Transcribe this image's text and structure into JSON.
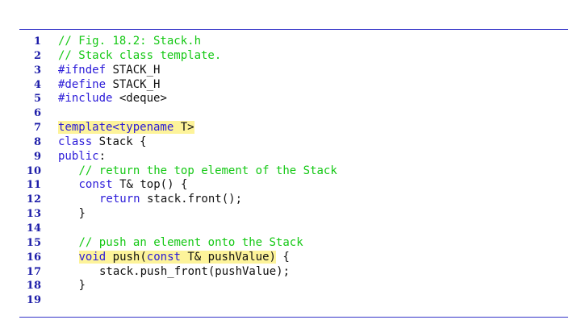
{
  "colors": {
    "comment": "#14c814",
    "keyword": "#2a1ad8",
    "line_number": "#1c1ca8",
    "highlight": "#fdf39a",
    "rule": "#3434c8"
  },
  "lines": [
    {
      "n": "1",
      "indent": 0,
      "tokens": [
        {
          "t": "// Fig. 18.2: Stack.h",
          "c": "comment"
        }
      ]
    },
    {
      "n": "2",
      "indent": 0,
      "tokens": [
        {
          "t": "// Stack class template.",
          "c": "comment"
        }
      ]
    },
    {
      "n": "3",
      "indent": 0,
      "tokens": [
        {
          "t": "#ifndef",
          "c": "keyword"
        },
        {
          "t": " STACK_H",
          "c": "plain"
        }
      ]
    },
    {
      "n": "4",
      "indent": 0,
      "tokens": [
        {
          "t": "#define",
          "c": "keyword"
        },
        {
          "t": " STACK_H",
          "c": "plain"
        }
      ]
    },
    {
      "n": "5",
      "indent": 0,
      "tokens": [
        {
          "t": "#include",
          "c": "keyword"
        },
        {
          "t": " <deque>",
          "c": "plain"
        }
      ]
    },
    {
      "n": "6",
      "indent": 0,
      "tokens": []
    },
    {
      "n": "7",
      "indent": 0,
      "tokens": [
        {
          "t": "template<typename",
          "c": "keyword",
          "hl": true
        },
        {
          "t": " T>",
          "c": "plain",
          "hl": true
        }
      ]
    },
    {
      "n": "8",
      "indent": 0,
      "tokens": [
        {
          "t": "class",
          "c": "keyword"
        },
        {
          "t": " Stack {",
          "c": "plain"
        }
      ]
    },
    {
      "n": "9",
      "indent": 0,
      "tokens": [
        {
          "t": "public",
          "c": "keyword"
        },
        {
          "t": ":",
          "c": "plain"
        }
      ]
    },
    {
      "n": "10",
      "indent": 1,
      "tokens": [
        {
          "t": "// return the top element of the Stack",
          "c": "comment"
        }
      ]
    },
    {
      "n": "11",
      "indent": 1,
      "tokens": [
        {
          "t": "const",
          "c": "keyword"
        },
        {
          "t": " T& top() {",
          "c": "plain"
        }
      ]
    },
    {
      "n": "12",
      "indent": 2,
      "tokens": [
        {
          "t": "return",
          "c": "keyword"
        },
        {
          "t": " stack.front();",
          "c": "plain"
        }
      ]
    },
    {
      "n": "13",
      "indent": 1,
      "tokens": [
        {
          "t": "}",
          "c": "plain"
        }
      ]
    },
    {
      "n": "14",
      "indent": 0,
      "tokens": []
    },
    {
      "n": "15",
      "indent": 1,
      "tokens": [
        {
          "t": "// push an element onto the Stack",
          "c": "comment"
        }
      ]
    },
    {
      "n": "16",
      "indent": 1,
      "tokens": [
        {
          "t": "void",
          "c": "keyword",
          "hl": true
        },
        {
          "t": " push(",
          "c": "plain",
          "hl": true
        },
        {
          "t": "const",
          "c": "keyword",
          "hl": true
        },
        {
          "t": " T& pushValue)",
          "c": "plain",
          "hl": true
        },
        {
          "t": " {",
          "c": "plain"
        }
      ]
    },
    {
      "n": "17",
      "indent": 2,
      "tokens": [
        {
          "t": "stack.push_front(pushValue);",
          "c": "plain"
        }
      ]
    },
    {
      "n": "18",
      "indent": 1,
      "tokens": [
        {
          "t": "}",
          "c": "plain"
        }
      ]
    },
    {
      "n": "19",
      "indent": 0,
      "tokens": []
    }
  ]
}
